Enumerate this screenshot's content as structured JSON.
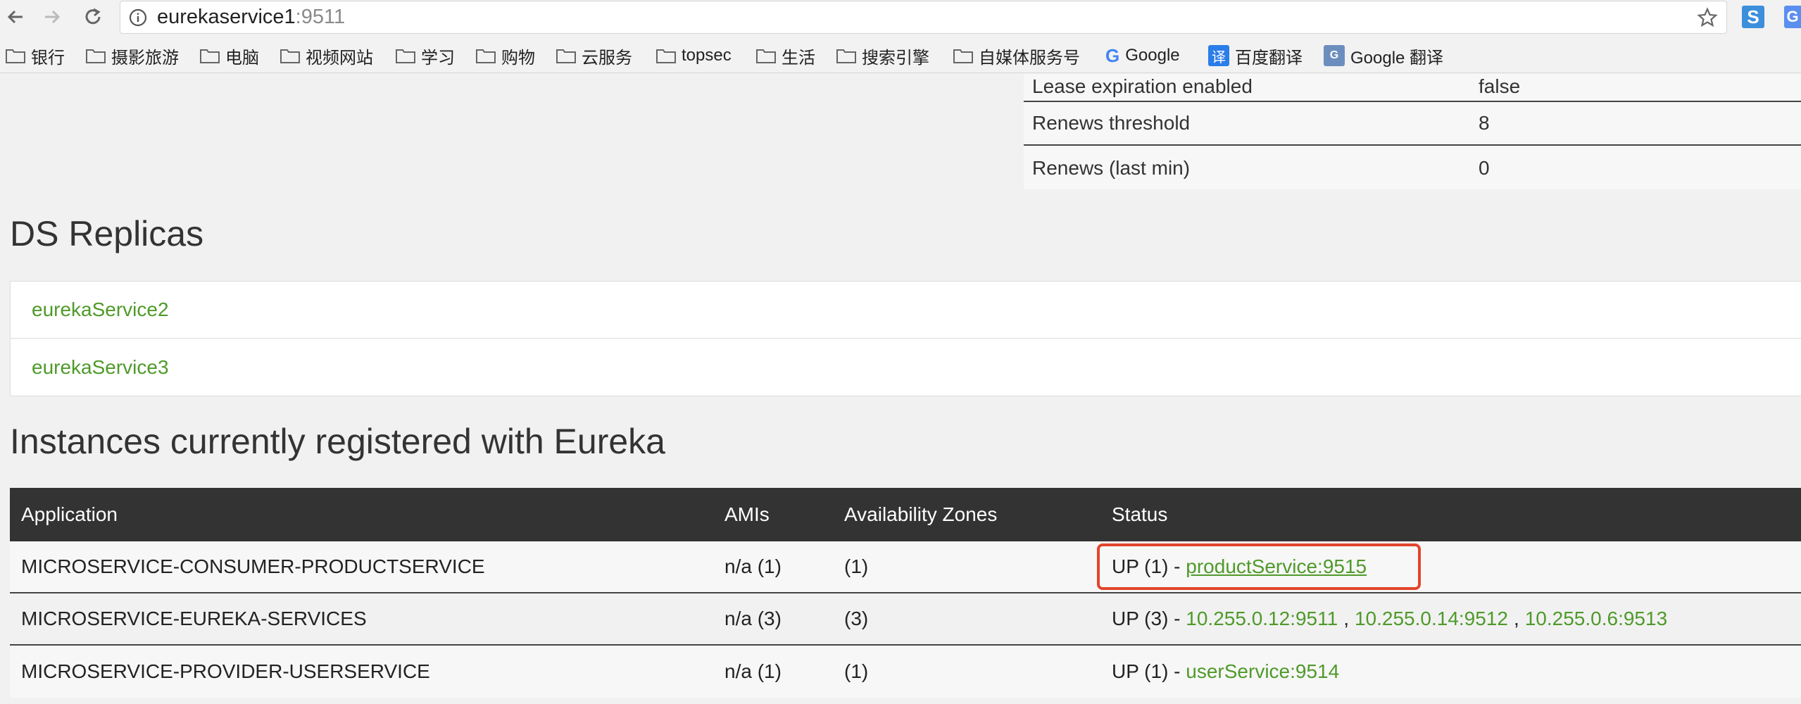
{
  "browser": {
    "url_host": "eurekaservice1",
    "url_port": ":9511",
    "extension_1": "S",
    "extension_2": "G"
  },
  "bookmarks": [
    {
      "label": "银行"
    },
    {
      "label": "摄影旅游"
    },
    {
      "label": "电脑"
    },
    {
      "label": "视频网站"
    },
    {
      "label": "学习"
    },
    {
      "label": "购物"
    },
    {
      "label": "云服务"
    },
    {
      "label": "topsec"
    },
    {
      "label": "生活"
    },
    {
      "label": "搜索引擎"
    },
    {
      "label": "自媒体服务号"
    },
    {
      "label": "Google",
      "icon_text": "G"
    },
    {
      "label": "百度翻译",
      "icon_text": "译"
    },
    {
      "label": "Google 翻译",
      "icon_text": "G"
    }
  ],
  "general_info": {
    "rows": [
      {
        "key": "Lease expiration enabled",
        "value": "false"
      },
      {
        "key": "Renews threshold",
        "value": "8"
      },
      {
        "key": "Renews (last min)",
        "value": "0"
      }
    ]
  },
  "replicas": {
    "title": "DS Replicas",
    "items": [
      "eurekaService2",
      "eurekaService3"
    ]
  },
  "instances": {
    "title": "Instances currently registered with Eureka",
    "headers": {
      "application": "Application",
      "amis": "AMIs",
      "zones": "Availability Zones",
      "status": "Status"
    },
    "rows": [
      {
        "application": "MICROSERVICE-CONSUMER-PRODUCTSERVICE",
        "amis": "n/a (1)",
        "zones": "(1)",
        "status_prefix": "UP (1) -",
        "links": [
          "productService:9515"
        ]
      },
      {
        "application": "MICROSERVICE-EUREKA-SERVICES",
        "amis": "n/a (3)",
        "zones": "(3)",
        "status_prefix": "UP (3) -",
        "links": [
          "10.255.0.12:9511",
          "10.255.0.14:9512",
          "10.255.0.6:9513"
        ],
        "separator": ","
      },
      {
        "application": "MICROSERVICE-PROVIDER-USERSERVICE",
        "amis": "n/a (1)",
        "zones": "(1)",
        "status_prefix": "UP (1) -",
        "links": [
          "userService:9514"
        ]
      }
    ]
  },
  "colors": {
    "link": "#4f9a2a",
    "table_header": "#333333",
    "highlight": "#e2452b"
  }
}
